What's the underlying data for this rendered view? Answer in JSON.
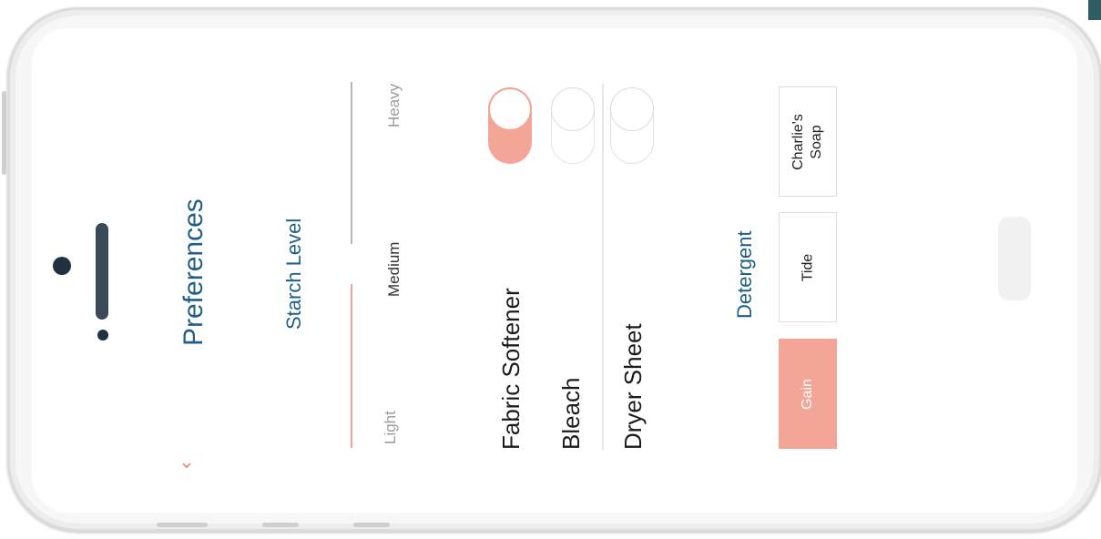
{
  "screen": {
    "title": "Preferences",
    "back_icon": "chevron-down-icon"
  },
  "starch": {
    "label": "Starch Level",
    "levels": [
      "Light",
      "Medium",
      "Heavy"
    ],
    "selected": "Medium"
  },
  "options": {
    "fabric_softener": {
      "label": "Fabric Softener",
      "on": true
    },
    "bleach": {
      "label": "Bleach",
      "on": false
    },
    "dryer_sheet": {
      "label": "Dryer Sheet",
      "on": false
    }
  },
  "detergent": {
    "label": "Detergent",
    "choices": [
      {
        "name": "Gain",
        "selected": true
      },
      {
        "name": "Tide",
        "selected": false
      },
      {
        "name": "Charlie's\nSoap",
        "selected": false
      }
    ]
  },
  "colors": {
    "accent": "#f3a597",
    "accent_dark": "#f08e7a",
    "primary_text": "#1f5f86",
    "phone_bezel": "#f7f7f7"
  }
}
